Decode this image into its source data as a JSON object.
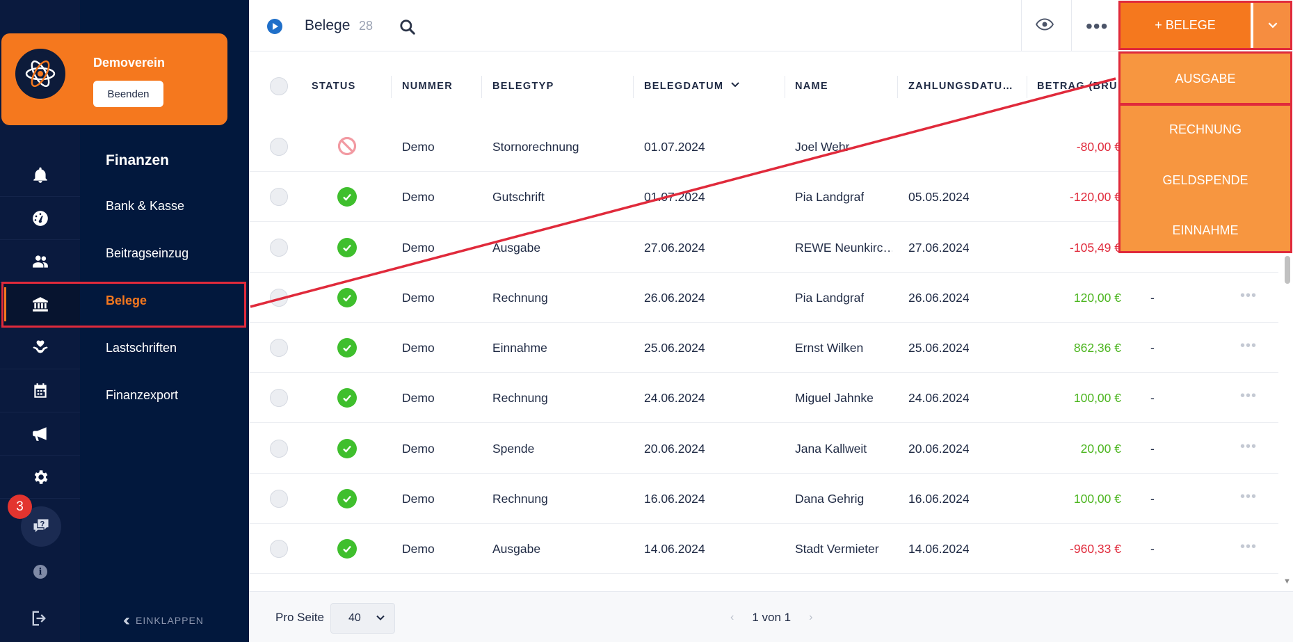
{
  "org": {
    "name": "Demoverein",
    "end_button": "Beenden"
  },
  "rail": {
    "icons": [
      "bell-icon",
      "dashboard-icon",
      "members-icon",
      "bank-icon",
      "donation-icon",
      "calendar-icon",
      "megaphone-icon",
      "settings-icon"
    ],
    "notification_count": "3"
  },
  "subnav": {
    "title": "Finanzen",
    "items": [
      "Bank & Kasse",
      "Beitragseinzug",
      "Belege",
      "Lastschriften",
      "Finanzexport"
    ],
    "active": "Belege",
    "collapse_label": "EINKLAPPEN"
  },
  "header": {
    "title": "Belege",
    "count": "28"
  },
  "add_button": {
    "label": "+ BELEGE",
    "menu": [
      "AUSGABE",
      "RECHNUNG",
      "GELDSPENDE",
      "EINNAHME"
    ]
  },
  "table": {
    "columns": [
      "STATUS",
      "NUMMER",
      "BELEGTYP",
      "BELEGDATUM",
      "NAME",
      "ZAHLUNGSDATU…",
      "BETRAG (BRU…"
    ],
    "rows": [
      {
        "status": "storniert",
        "nummer": "Demo",
        "belegtyp": "Stornorechnung",
        "belegdatum": "01.07.2024",
        "name": "Joel Wehr",
        "zahlungsdatum": "",
        "betrag": "-80,00 €",
        "sign": "neg",
        "extra": "-"
      },
      {
        "status": "ok",
        "nummer": "Demo",
        "belegtyp": "Gutschrift",
        "belegdatum": "01.07.2024",
        "name": "Pia Landgraf",
        "zahlungsdatum": "05.05.2024",
        "betrag": "-120,00 €",
        "sign": "neg",
        "extra": "-"
      },
      {
        "status": "ok",
        "nummer": "Demo",
        "belegtyp": "Ausgabe",
        "belegdatum": "27.06.2024",
        "name": "REWE Neunkirc…",
        "zahlungsdatum": "27.06.2024",
        "betrag": "-105,49 €",
        "sign": "neg",
        "extra": "-"
      },
      {
        "status": "ok",
        "nummer": "Demo",
        "belegtyp": "Rechnung",
        "belegdatum": "26.06.2024",
        "name": "Pia Landgraf",
        "zahlungsdatum": "26.06.2024",
        "betrag": "120,00 €",
        "sign": "pos",
        "extra": "-"
      },
      {
        "status": "ok",
        "nummer": "Demo",
        "belegtyp": "Einnahme",
        "belegdatum": "25.06.2024",
        "name": "Ernst Wilken",
        "zahlungsdatum": "25.06.2024",
        "betrag": "862,36 €",
        "sign": "pos",
        "extra": "-"
      },
      {
        "status": "ok",
        "nummer": "Demo",
        "belegtyp": "Rechnung",
        "belegdatum": "24.06.2024",
        "name": "Miguel Jahnke",
        "zahlungsdatum": "24.06.2024",
        "betrag": "100,00 €",
        "sign": "pos",
        "extra": "-"
      },
      {
        "status": "ok",
        "nummer": "Demo",
        "belegtyp": "Spende",
        "belegdatum": "20.06.2024",
        "name": "Jana Kallweit",
        "zahlungsdatum": "20.06.2024",
        "betrag": "20,00 €",
        "sign": "pos",
        "extra": "-"
      },
      {
        "status": "ok",
        "nummer": "Demo",
        "belegtyp": "Rechnung",
        "belegdatum": "16.06.2024",
        "name": "Dana Gehrig",
        "zahlungsdatum": "16.06.2024",
        "betrag": "100,00 €",
        "sign": "pos",
        "extra": "-"
      },
      {
        "status": "ok",
        "nummer": "Demo",
        "belegtyp": "Ausgabe",
        "belegdatum": "14.06.2024",
        "name": "Stadt Vermieter",
        "zahlungsdatum": "14.06.2024",
        "betrag": "-960,33 €",
        "sign": "neg",
        "extra": "-"
      }
    ]
  },
  "footer": {
    "per_page_label": "Pro Seite",
    "per_page_value": "40",
    "pagination": "1 von 1"
  },
  "colors": {
    "accent": "#f5781e",
    "sidebar": "#0a1a3e",
    "negative": "#e02a3b",
    "positive": "#4bb51e",
    "highlight": "#e02a3b"
  }
}
